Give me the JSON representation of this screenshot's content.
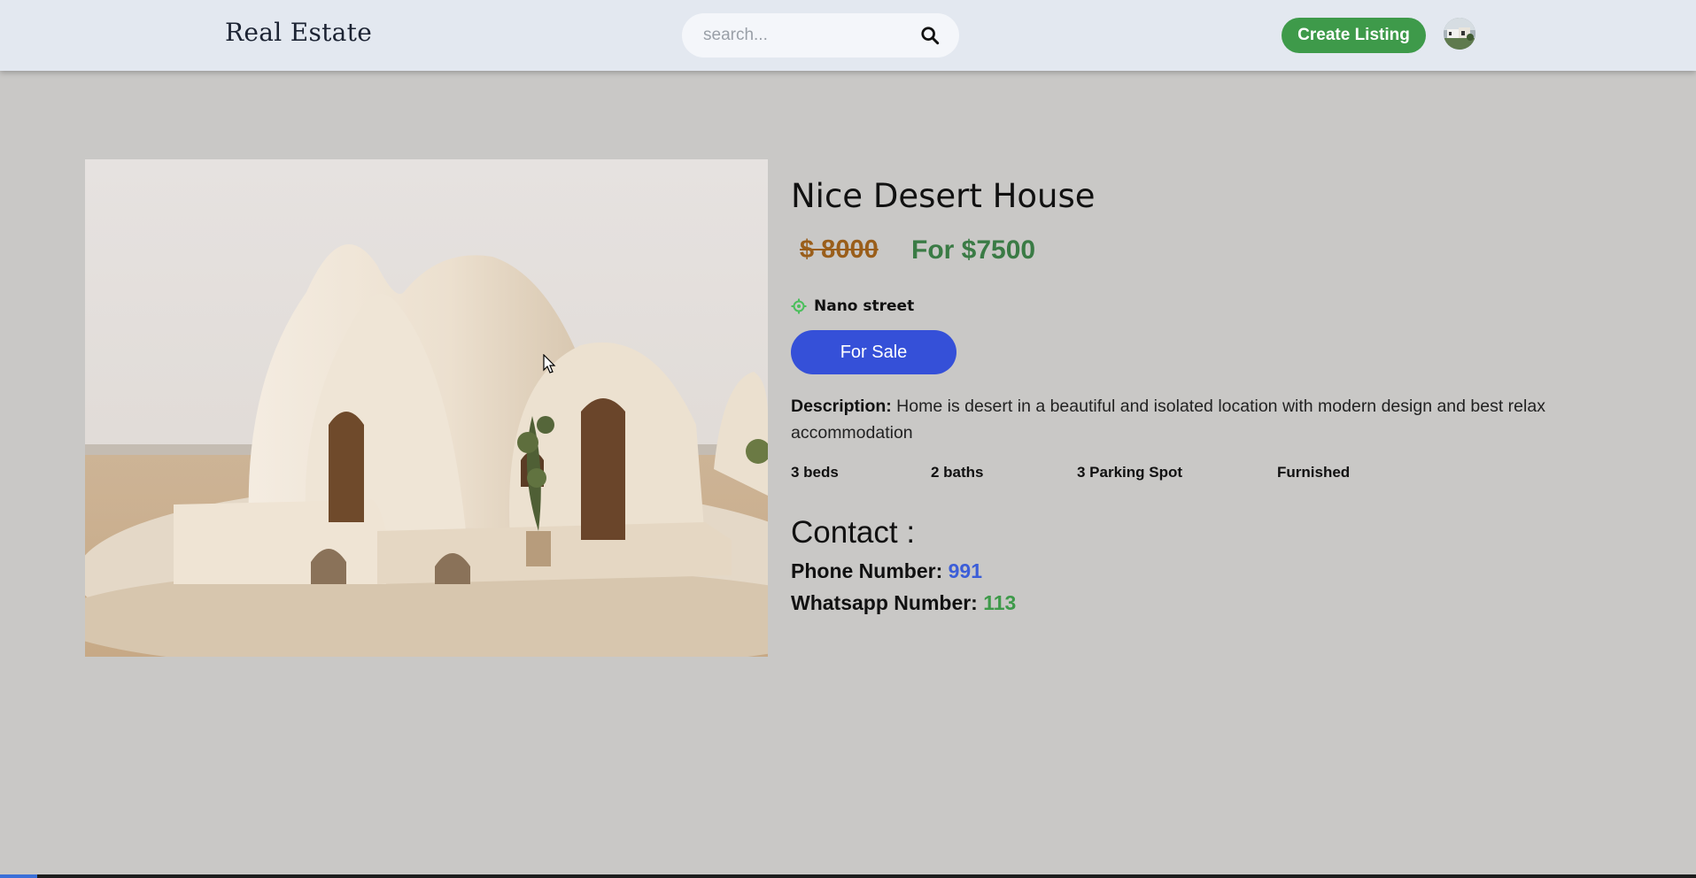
{
  "header": {
    "logo": "Real Estate",
    "search_placeholder": "search...",
    "search_icon": "search-icon",
    "create_listing_label": "Create Listing",
    "avatar_icon": "user-avatar"
  },
  "listing": {
    "title": "Nice Desert House",
    "regular_price": "$ 8000",
    "discount_price": "For $7500",
    "address": "Nano street",
    "address_icon": "location-icon",
    "type_label": "For Sale",
    "description_label": "Description:",
    "description_text": " Home is desert in a beautiful and isolated location with modern design and best relax accommodation",
    "features": [
      "3 beds",
      "2 baths",
      "3 Parking Spot",
      "Furnished"
    ]
  },
  "contact": {
    "title": "Contact :",
    "phone_label": "Phone Number: ",
    "phone_value": "991",
    "whatsapp_label": "Whatsapp Number: ",
    "whatsapp_value": "113"
  },
  "colors": {
    "background": "#c9c8c6",
    "header": "#e3e8f0",
    "create_button": "#3e9a4a",
    "sale_button": "#3550d8",
    "old_price": "#9a5e1a",
    "new_price": "#3a7b45",
    "phone": "#3c5ed8",
    "whatsapp": "#3e9a4a"
  }
}
